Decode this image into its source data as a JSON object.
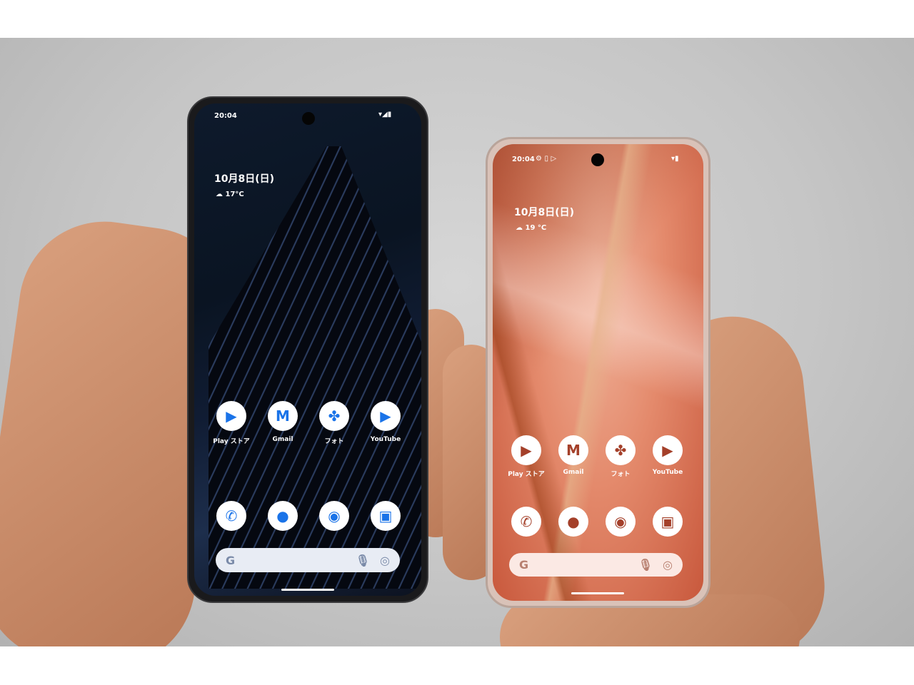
{
  "left_phone": {
    "status_time": "20:04",
    "status_icons": [
      "wifi-icon",
      "signal-icon",
      "battery-icon"
    ],
    "date": "10月8日(日)",
    "weather": "17°C",
    "apps": [
      {
        "label": "Play ストア",
        "icon": "play-store-icon"
      },
      {
        "label": "Gmail",
        "icon": "gmail-icon"
      },
      {
        "label": "フォト",
        "icon": "photos-icon"
      },
      {
        "label": "YouTube",
        "icon": "youtube-icon"
      }
    ],
    "dock": [
      "phone-icon",
      "messages-icon",
      "chrome-icon",
      "camera-icon"
    ],
    "search_logo": "G",
    "accent": "#1a73e8"
  },
  "right_phone": {
    "status_time": "20:04",
    "status_icons": [
      "settings-icon",
      "sim-icon",
      "play-icon",
      "wifi-icon",
      "battery-icon"
    ],
    "date": "10月8日(日)",
    "weather": "19 °C",
    "apps": [
      {
        "label": "Play ストア",
        "icon": "play-store-icon"
      },
      {
        "label": "Gmail",
        "icon": "gmail-icon"
      },
      {
        "label": "フォト",
        "icon": "photos-icon"
      },
      {
        "label": "YouTube",
        "icon": "youtube-icon"
      }
    ],
    "dock": [
      "phone-icon",
      "messages-icon",
      "chrome-icon",
      "camera-icon"
    ],
    "search_logo": "G",
    "accent": "#a4402a"
  }
}
